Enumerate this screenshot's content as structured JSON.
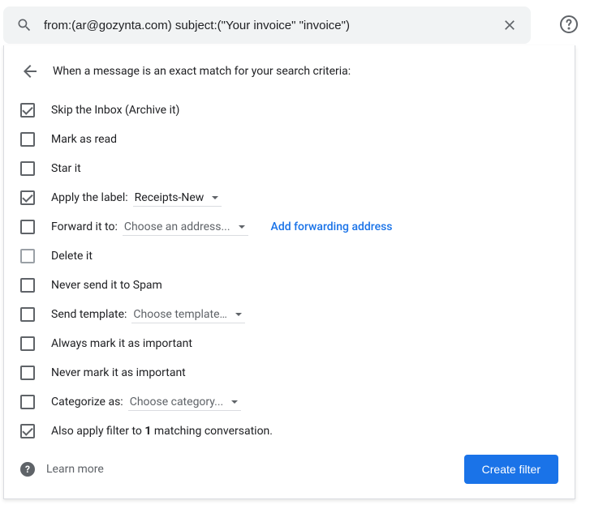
{
  "search": {
    "query": "from:(ar@gozynta.com) subject:(\"Your invoice\" \"invoice\")"
  },
  "panel": {
    "header": "When a message is an exact match for your search criteria:"
  },
  "options": {
    "skip_inbox": {
      "label": "Skip the Inbox (Archive it)",
      "checked": true
    },
    "mark_read": {
      "label": "Mark as read",
      "checked": false
    },
    "star": {
      "label": "Star it",
      "checked": false
    },
    "apply_label": {
      "label": "Apply the label:",
      "checked": true,
      "value": "Receipts-New"
    },
    "forward": {
      "label": "Forward it to:",
      "checked": false,
      "value": "Choose an address...",
      "link": "Add forwarding address"
    },
    "delete": {
      "label": "Delete it",
      "checked": false
    },
    "never_spam": {
      "label": "Never send it to Spam",
      "checked": false
    },
    "template": {
      "label": "Send template:",
      "checked": false,
      "value": "Choose template…"
    },
    "always_important": {
      "label": "Always mark it as important",
      "checked": false
    },
    "never_important": {
      "label": "Never mark it as important",
      "checked": false
    },
    "categorize": {
      "label": "Categorize as:",
      "checked": false,
      "value": "Choose category..."
    },
    "also_apply": {
      "prefix": "Also apply filter to ",
      "count": "1",
      "suffix": " matching conversation.",
      "checked": true
    }
  },
  "footer": {
    "learn_more": "Learn more",
    "create": "Create filter"
  }
}
